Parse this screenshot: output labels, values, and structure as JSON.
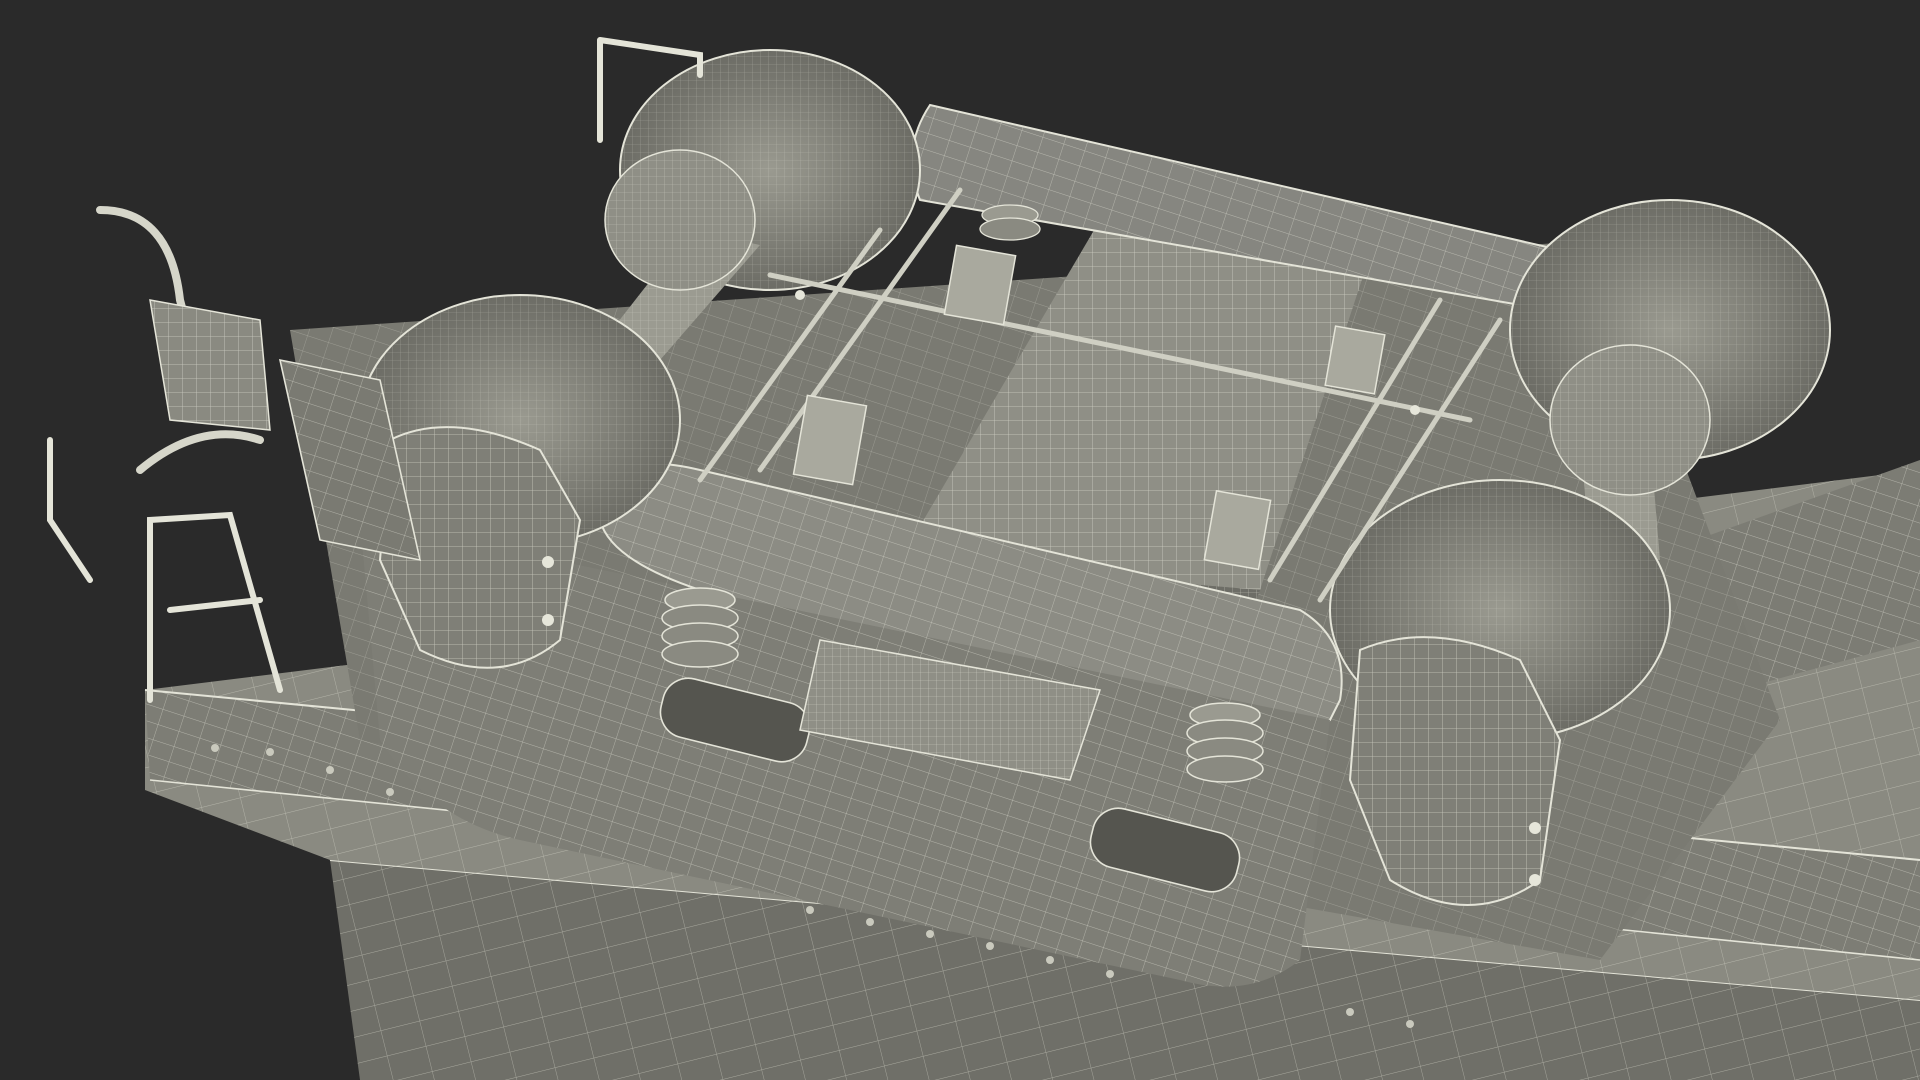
{
  "scene": {
    "subject": "bogie-wireframe-render",
    "colors": {
      "background": "#2a2a2a",
      "body_fill": "#8d8d84",
      "body_shade": "#6f6f68",
      "body_dark": "#55554f",
      "wire": "#e4e4d8",
      "wire_dim": "#b9b9ad"
    },
    "components": [
      "car-body-floor",
      "car-side-skirt",
      "bogie-frame",
      "front-left-wheel",
      "front-right-wheel",
      "rear-left-wheel",
      "rear-right-wheel",
      "front-axle",
      "rear-axle",
      "bolster",
      "center-plate",
      "primary-springs",
      "traction-motor",
      "brake-rigging",
      "handrail",
      "brake-hose"
    ]
  }
}
